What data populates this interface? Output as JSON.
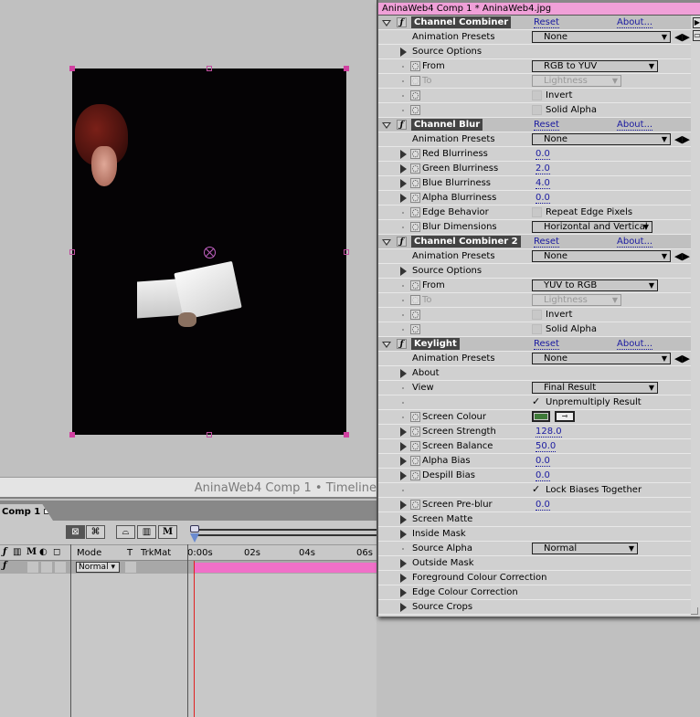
{
  "composition": {
    "description": "Comp viewer showing keyed footage: woman's head and white paper on black"
  },
  "timeline": {
    "window_title": "AninaWeb4 Comp 1 • Timeline",
    "tab_label": "Comp 1",
    "switch_icons": [
      "ƒ",
      "▥",
      "M",
      "◐",
      "◻"
    ],
    "columns": {
      "mode": "Mode",
      "t": "T",
      "trkmat": "TrkMat"
    },
    "ruler_ticks": [
      "0:00s",
      "02s",
      "04s",
      "06s"
    ],
    "layer": {
      "fx": "ƒ",
      "mode": "Normal"
    }
  },
  "effect_controls": {
    "title": "AninaWeb4 Comp 1 * AninaWeb4.jpg",
    "reset_label": "Reset",
    "about_label": "About...",
    "animation_presets_label": "Animation Presets",
    "effects": [
      {
        "name": "Channel Combiner",
        "preset": "None",
        "rows": [
          {
            "type": "group",
            "label": "Source Options"
          },
          {
            "type": "select",
            "label": "From",
            "value": "RGB to YUV",
            "stopwatch": true
          },
          {
            "type": "select",
            "label": "To",
            "value": "Lightness",
            "stopwatch": true,
            "disabled": true
          },
          {
            "type": "checkbox",
            "label": "",
            "option": "Invert",
            "checked": false,
            "stopwatch": true
          },
          {
            "type": "checkbox",
            "label": "",
            "option": "Solid Alpha",
            "checked": false,
            "stopwatch": true
          }
        ]
      },
      {
        "name": "Channel Blur",
        "preset": "None",
        "rows": [
          {
            "type": "value",
            "label": "Red Blurriness",
            "value": "0.0",
            "stopwatch": true
          },
          {
            "type": "value",
            "label": "Green Blurriness",
            "value": "2.0",
            "stopwatch": true
          },
          {
            "type": "value",
            "label": "Blue Blurriness",
            "value": "4.0",
            "stopwatch": true
          },
          {
            "type": "value",
            "label": "Alpha Blurriness",
            "value": "0.0",
            "stopwatch": true
          },
          {
            "type": "checkbox",
            "label": "Edge Behavior",
            "option": "Repeat Edge Pixels",
            "checked": false,
            "stopwatch": true
          },
          {
            "type": "select",
            "label": "Blur Dimensions",
            "value": "Horizontal and Vertical",
            "stopwatch": true
          }
        ]
      },
      {
        "name": "Channel Combiner 2",
        "preset": "None",
        "rows": [
          {
            "type": "group",
            "label": "Source Options"
          },
          {
            "type": "select",
            "label": "From",
            "value": "YUV to RGB",
            "stopwatch": true
          },
          {
            "type": "select",
            "label": "To",
            "value": "Lightness",
            "stopwatch": true,
            "disabled": true
          },
          {
            "type": "checkbox",
            "label": "",
            "option": "Invert",
            "checked": false,
            "stopwatch": true
          },
          {
            "type": "checkbox",
            "label": "",
            "option": "Solid Alpha",
            "checked": false,
            "stopwatch": true
          }
        ]
      },
      {
        "name": "Keylight",
        "preset": "None",
        "rows": [
          {
            "type": "group",
            "label": "About"
          },
          {
            "type": "select",
            "label": "View",
            "value": "Final Result",
            "stopwatch": false
          },
          {
            "type": "checkbox",
            "label": "",
            "option": "Unpremultiply Result",
            "checked": true,
            "stopwatch": false
          },
          {
            "type": "color",
            "label": "Screen Colour",
            "value": "#3e7a38",
            "stopwatch": true
          },
          {
            "type": "value",
            "label": "Screen Strength",
            "value": "128.0",
            "stopwatch": true
          },
          {
            "type": "value",
            "label": "Screen Balance",
            "value": "50.0",
            "stopwatch": true
          },
          {
            "type": "value",
            "label": "Alpha Bias",
            "value": "0.0",
            "stopwatch": true
          },
          {
            "type": "value",
            "label": "Despill Bias",
            "value": "0.0",
            "stopwatch": true
          },
          {
            "type": "checkbox",
            "label": "",
            "option": "Lock Biases Together",
            "checked": true,
            "stopwatch": false
          },
          {
            "type": "value",
            "label": "Screen Pre-blur",
            "value": "0.0",
            "stopwatch": true
          },
          {
            "type": "group",
            "label": "Screen Matte"
          },
          {
            "type": "group",
            "label": "Inside Mask"
          },
          {
            "type": "select",
            "label": "Source Alpha",
            "value": "Normal",
            "stopwatch": false
          },
          {
            "type": "group",
            "label": "Outside Mask"
          },
          {
            "type": "group",
            "label": "Foreground Colour Correction"
          },
          {
            "type": "group",
            "label": "Edge Colour Correction"
          },
          {
            "type": "group",
            "label": "Source Crops"
          }
        ]
      }
    ]
  },
  "colors": {
    "title_bar_pink": "#f0a0d8",
    "layer_bar_pink": "#f070c8",
    "link_blue": "#1a1aa0",
    "handle_magenta": "#d040a0",
    "cti_red": "#e02020"
  }
}
